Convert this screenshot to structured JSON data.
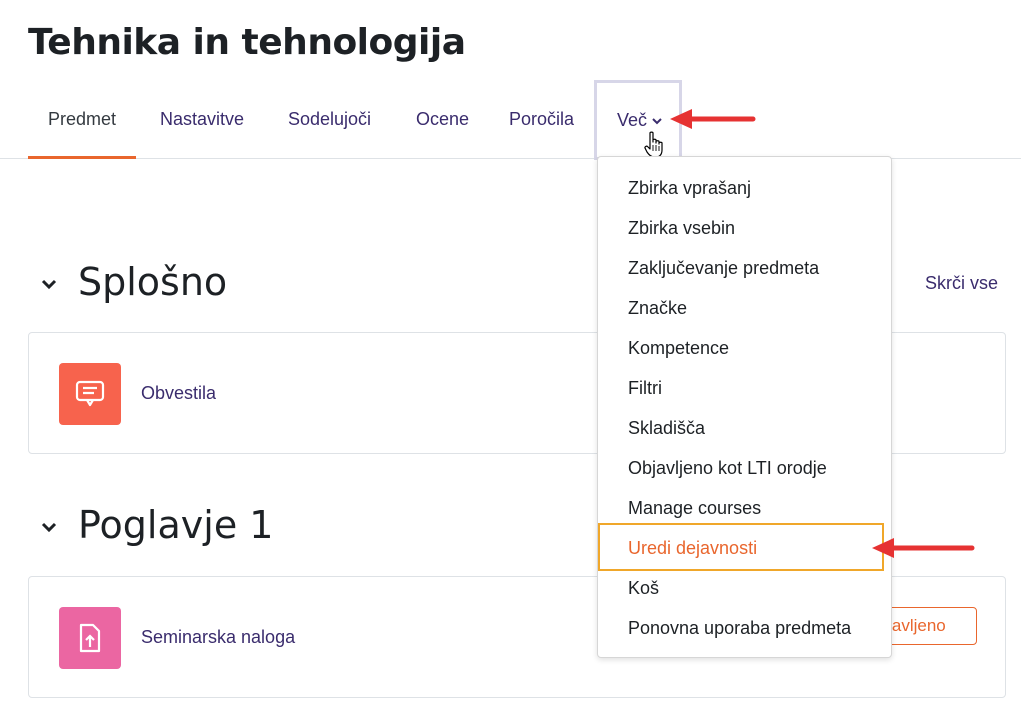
{
  "page": {
    "title": "Tehnika in tehnologija"
  },
  "tabs": [
    {
      "label": "Predmet"
    },
    {
      "label": "Nastavitve"
    },
    {
      "label": "Sodelujoči"
    },
    {
      "label": "Ocene"
    },
    {
      "label": "Poročila"
    },
    {
      "label": "Več"
    }
  ],
  "collapse_all": "Skrči vse",
  "sections": [
    {
      "title": "Splošno",
      "activity": {
        "name": "Obvestila",
        "icon": "forum-announcement-icon",
        "icon_color": "#f7634d"
      }
    },
    {
      "title": "Poglavje 1",
      "activity": {
        "name": "Seminarska naloga",
        "icon": "assignment-upload-icon",
        "icon_color": "#eb66a2",
        "completion_button": "ravljeno"
      }
    }
  ],
  "more_menu": {
    "items": [
      "Zbirka vprašanj",
      "Zbirka vsebin",
      "Zaključevanje predmeta",
      "Značke",
      "Kompetence",
      "Filtri",
      "Skladišča",
      "Objavljeno kot LTI orodje",
      "Manage courses",
      "Uredi dejavnosti",
      "Koš",
      "Ponovna uporaba predmeta"
    ],
    "highlighted": "Uredi dejavnosti"
  },
  "colors": {
    "accent": "#e9662d",
    "link": "#3a2c6d",
    "annotation_arrow": "#e63232",
    "highlight_box": "#f0a72a"
  }
}
